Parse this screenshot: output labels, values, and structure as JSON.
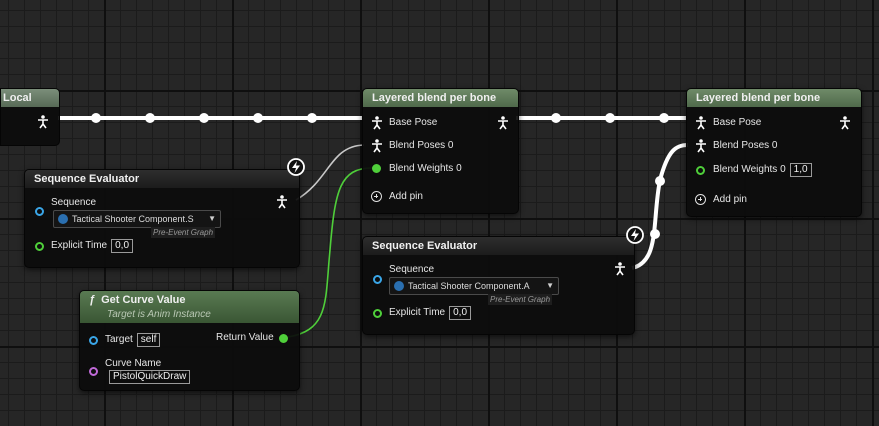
{
  "local_node": {
    "title": "Local"
  },
  "layered_blend_1": {
    "title": "Layered blend per bone",
    "base_pose": "Base Pose",
    "blend_poses": "Blend Poses 0",
    "blend_weights": "Blend Weights 0",
    "add_pin": "Add pin"
  },
  "layered_blend_2": {
    "title": "Layered blend per bone",
    "base_pose": "Base Pose",
    "blend_poses": "Blend Poses 0",
    "blend_weights": "Blend Weights 0",
    "blend_weights_value": "1,0",
    "add_pin": "Add pin"
  },
  "sequence_evaluator_1": {
    "title": "Sequence Evaluator",
    "sequence_label": "Sequence",
    "sequence_asset": "Tactical Shooter Component.S",
    "asset_tag": "Pre-Event Graph",
    "explicit_time_label": "Explicit Time",
    "explicit_time_value": "0,0"
  },
  "sequence_evaluator_2": {
    "title": "Sequence Evaluator",
    "sequence_label": "Sequence",
    "sequence_asset": "Tactical Shooter Component.A",
    "asset_tag": "Pre-Event Graph",
    "explicit_time_label": "Explicit Time",
    "explicit_time_value": "0,0"
  },
  "get_curve_value": {
    "title": "Get Curve Value",
    "subtitle": "Target is Anim Instance",
    "target_label": "Target",
    "target_value": "self",
    "return_label": "Return Value",
    "curve_name_label": "Curve Name",
    "curve_name_value": "PistolQuickDraw"
  },
  "colors": {
    "exec_pin": "#3aa6e8",
    "float_pin": "#4fcf3a",
    "name_pin": "#c06ad8",
    "pose_wire": "#ffffff",
    "float_wire": "#4fcf3a"
  }
}
